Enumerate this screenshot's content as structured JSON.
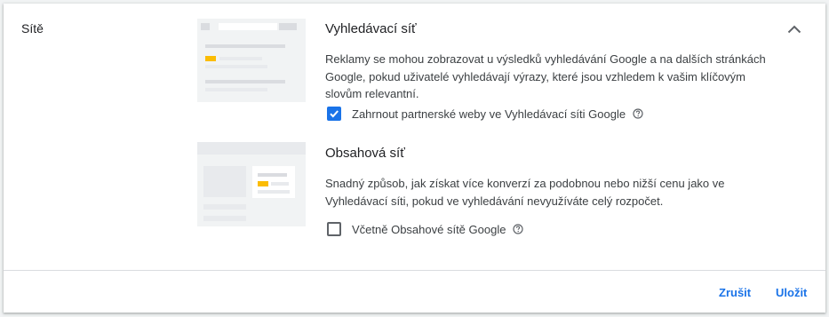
{
  "section": {
    "title": "Sítě"
  },
  "icons": {
    "collapse": "chevron-up-icon",
    "help": "help-circle-icon",
    "check": "checkmark-icon"
  },
  "colors": {
    "accent": "#1a73e8",
    "highlight": "#fbbc04",
    "placeholder": "#e8eaed"
  },
  "search_network": {
    "title": "Vyhledávací síť",
    "description": "Reklamy se mohou zobrazovat u výsledků vyhledávání Google a na dalších stránkách Google, pokud uživatelé vyhledávají výrazy, které jsou vzhledem k vašim klíčovým slovům relevantní.",
    "checkbox_label": "Zahrnout partnerské weby ve Vyhledávací síti Google",
    "checked": true
  },
  "display_network": {
    "title": "Obsahová síť",
    "description": "Snadný způsob, jak získat více konverzí za podobnou nebo nižší cenu jako ve Vyhledávací síti, pokud ve vyhledávání nevyužíváte celý rozpočet.",
    "checkbox_label": "Včetně Obsahové sítě Google",
    "checked": false
  },
  "actions": {
    "cancel": "Zrušit",
    "save": "Uložit"
  }
}
